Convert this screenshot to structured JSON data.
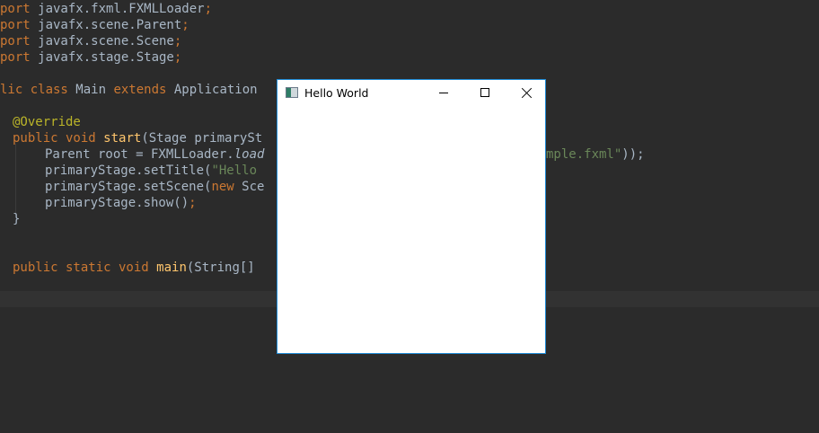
{
  "editor": {
    "lines": {
      "import1": {
        "kw": "port",
        "rest": " javafx.fxml.FXMLLoader",
        "end": ";"
      },
      "import2": {
        "kw": "port",
        "rest": " javafx.scene.Parent",
        "end": ";"
      },
      "import3": {
        "kw": "port",
        "rest": " javafx.scene.Scene",
        "end": ";"
      },
      "import4": {
        "kw": "port",
        "rest": " javafx.stage.Stage",
        "end": ";"
      },
      "class_decl": {
        "kw1": "lic class",
        "name": " Main ",
        "kw2": "extends",
        "rest": " Application"
      },
      "override": "@Override",
      "start_decl": {
        "kw": "public void",
        "fn": "start",
        "rest": "(Stage primarySt"
      },
      "parent_line": {
        "rest": "Parent root = FXMLLoader.",
        "it": "load",
        "tail_str": "mple.fxml\"",
        "tail_end": "));"
      },
      "set_title": {
        "rest": "primaryStage.setTitle(",
        "str": "\"Hello"
      },
      "set_scene": {
        "rest": "primaryStage.setScene(",
        "kw": "new",
        "tail": " Sce"
      },
      "show": {
        "rest": "primaryStage.show()",
        "end": ";"
      },
      "close_brace": "}",
      "main_decl": {
        "kw": "public static void",
        "fn": "main",
        "rest": "(String[]"
      }
    }
  },
  "window": {
    "title": "Hello World",
    "icon": "java-app-icon",
    "controls": {
      "minimize": "minimize-icon",
      "maximize": "maximize-icon",
      "close": "close-icon"
    },
    "accent": "#1e8ad6"
  },
  "colors": {
    "background": "#2b2b2b",
    "keyword": "#cc7832",
    "annotation": "#bbb529",
    "function": "#ffc66d",
    "string": "#6a8759",
    "text": "#a9b7c6"
  }
}
